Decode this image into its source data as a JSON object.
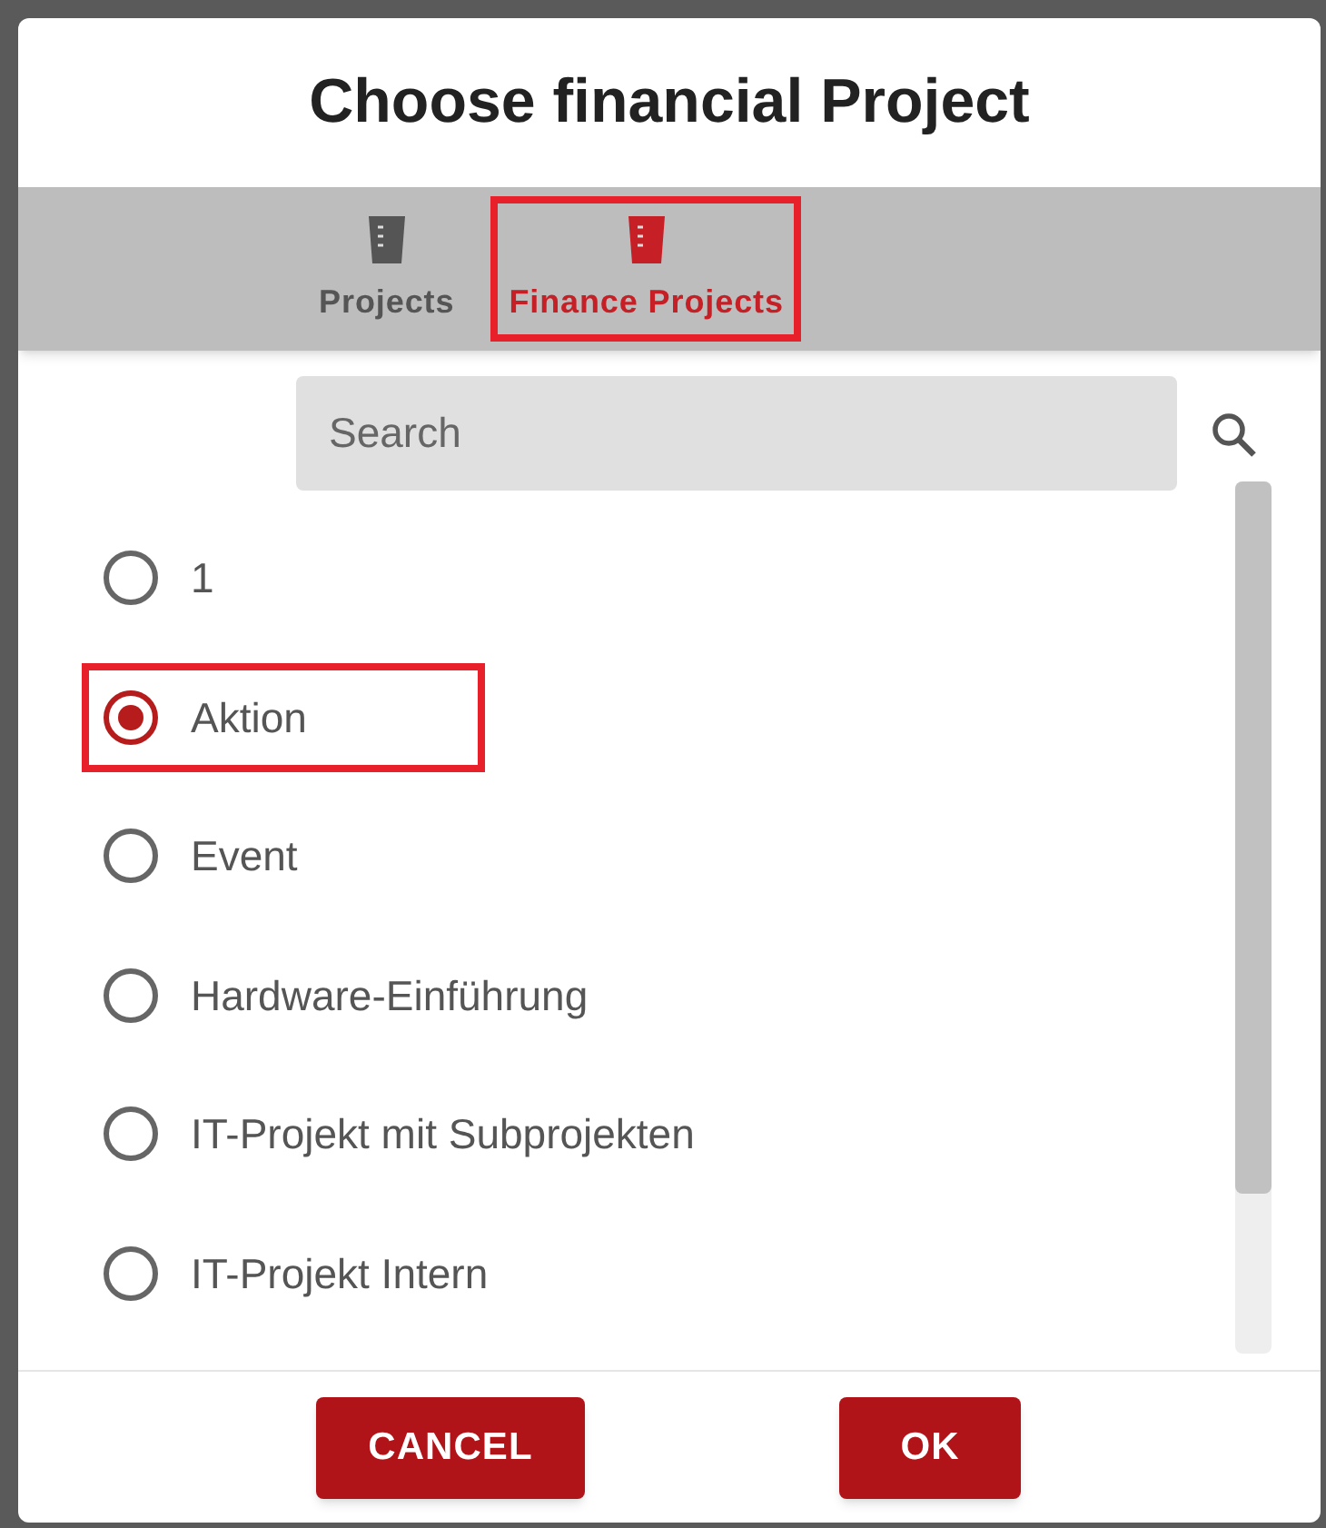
{
  "dialog": {
    "title": "Choose financial Project"
  },
  "tabs": [
    {
      "label": "Projects",
      "selected": false,
      "highlighted": false
    },
    {
      "label": "Finance Projects",
      "selected": true,
      "highlighted": true
    }
  ],
  "search": {
    "placeholder": "Search"
  },
  "options": [
    {
      "label": "1",
      "selected": false,
      "highlighted": false
    },
    {
      "label": "Aktion",
      "selected": true,
      "highlighted": true
    },
    {
      "label": "Event",
      "selected": false,
      "highlighted": false
    },
    {
      "label": "Hardware-Einführung",
      "selected": false,
      "highlighted": false
    },
    {
      "label": "IT-Projekt mit Subprojekten",
      "selected": false,
      "highlighted": false
    },
    {
      "label": "IT-Projekt Intern",
      "selected": false,
      "highlighted": false
    }
  ],
  "buttons": [
    {
      "label": "CANCEL"
    },
    {
      "label": "OK"
    }
  ]
}
